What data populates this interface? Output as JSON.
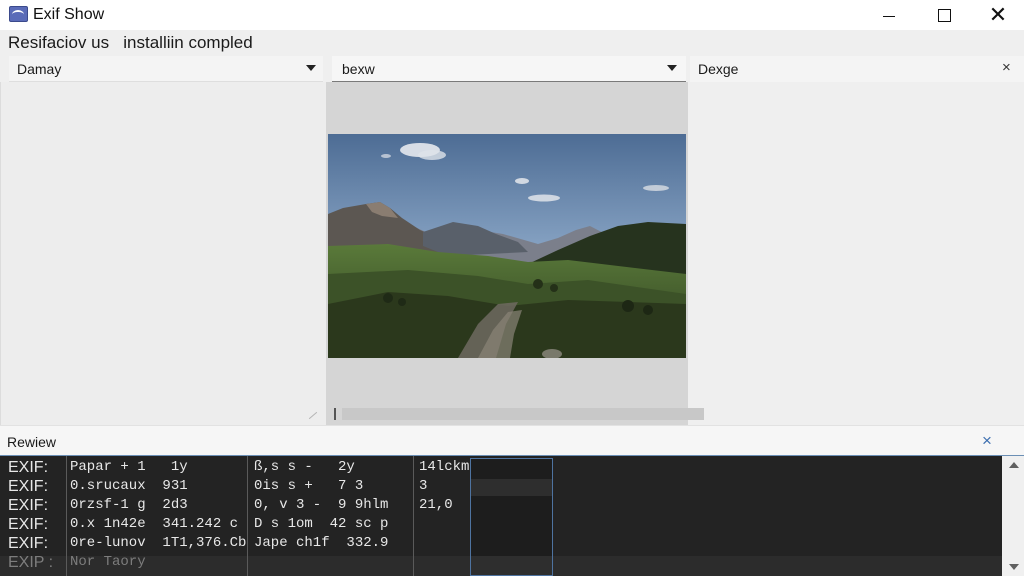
{
  "window": {
    "title": "Exif Show",
    "icon": "app-icon",
    "controls": [
      "minimize-icon",
      "maximize-icon",
      "close-icon"
    ]
  },
  "status": {
    "text": "Resifaciov us   installiin compled"
  },
  "panes": {
    "left": {
      "label": "Damay"
    },
    "middle": {
      "label": "bexw"
    },
    "right": {
      "label": "Dexge",
      "close": "×"
    }
  },
  "review": {
    "label": "Rewiew",
    "close": "×"
  },
  "console": {
    "rows": [
      {
        "prefix": "EXIF:",
        "a": "Papar + 1   1y",
        "b": "ß,s s -   2y",
        "c": "14lckm",
        "dim": false
      },
      {
        "prefix": "EXIF:",
        "a": "0.srucaux  931",
        "b": "0is s +   7 3",
        "c": "3",
        "dim": false
      },
      {
        "prefix": "EXIF:",
        "a": "0rzsf-1 g  2d3",
        "b": "0, v 3 -  9 9hlm",
        "c": "21,0",
        "dim": false
      },
      {
        "prefix": "EXIF:",
        "a": "0.x 1n42e  341.242 c",
        "b": "D s 1om  42 sc p",
        "c": "",
        "dim": false
      },
      {
        "prefix": "EXIF:",
        "a": "0re-lunov  1T1,376.Cb",
        "b": "Jape ch1f  332.9",
        "c": "",
        "dim": false
      },
      {
        "prefix": "EXIP :",
        "a": "Nor Taory",
        "b": "",
        "c": "",
        "dim": true
      }
    ]
  }
}
